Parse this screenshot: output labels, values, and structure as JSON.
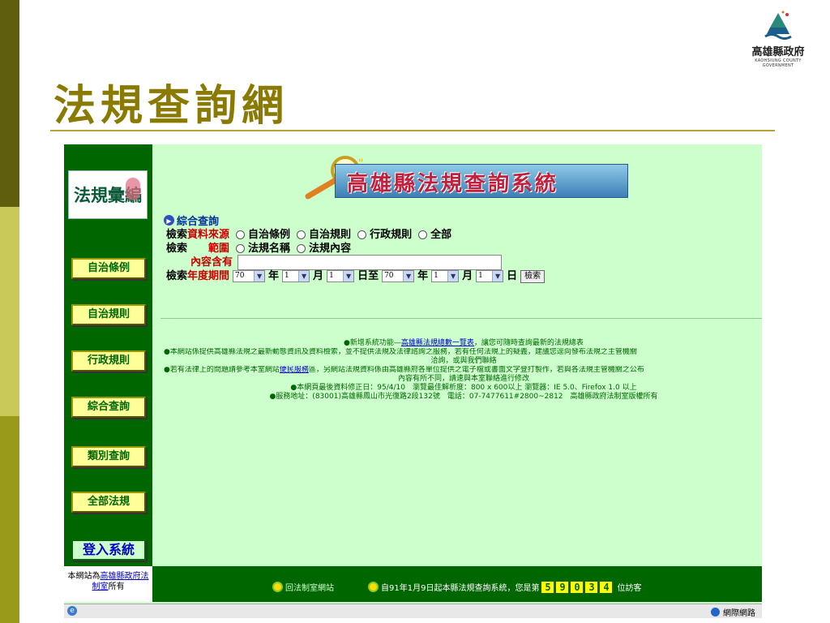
{
  "slide": {
    "title": "法規查詢網",
    "logo_name": "高雄縣政府",
    "logo_sub": "KAOHSIUNG COUNTY GOVERNMENT"
  },
  "sidebar": {
    "logo_label": "法規彙編",
    "items": [
      {
        "label": "自治條例"
      },
      {
        "label": "自治規則"
      },
      {
        "label": "行政規則"
      },
      {
        "label": "綜合查詢"
      },
      {
        "label": "類別查詢"
      },
      {
        "label": "全部法規"
      },
      {
        "label": "登入系統"
      }
    ],
    "footer_prefix": "本網站為",
    "footer_link": "高雄縣政府法制室",
    "footer_suffix": "所有"
  },
  "banner": {
    "title": "高雄縣法規查詢系統"
  },
  "search": {
    "heading": "綜合查詢",
    "source_prefix": "檢索",
    "source_label": "資料來源",
    "source_options": [
      "自治條例",
      "自治規則",
      "行政規則",
      "全部"
    ],
    "scope_prefix": "檢索",
    "scope_label": "範圍",
    "scope_options": [
      "法規名稱",
      "法規內容"
    ],
    "content_label": "內容含有",
    "content_value": "",
    "period_prefix": "檢索",
    "period_label": "年度期間",
    "year_from": "70",
    "month_from": "1",
    "day_from": "1",
    "year_to": "70",
    "month_to": "1",
    "day_to": "1",
    "unit_year": "年",
    "unit_month": "月",
    "unit_day_to": "日至",
    "unit_day": "日",
    "button": "檢索"
  },
  "notice": {
    "line1_prefix": "●新增系統功能—",
    "line1_link": "高雄縣法規總數一覽表",
    "line1_suffix": "，讓您可隨時查詢最新的法規總表",
    "line2": "●本網站係提供高雄縣法規之最新動態資訊及資料檢索，並不提供法規及法律諮詢之服務，若有任何法規上的疑義，建議您逕向發布法規之主管機關",
    "line3": "洽詢，或與我們聯絡",
    "line4_prefix": "●若有法律上的問題請參考本室網站",
    "line4_link": "便民服務",
    "line4_suffix": "區，另網站法規資料係由高雄縣府各單位提供之電子檔或書面文字登打製作，若與各法規主管機關之公布",
    "line5": "內容有所不同，請速與本室聯絡進行修改",
    "line6": "●本網頁最後資料修正日：95/4/10　瀏覽最佳解析度：800 x 600以上 瀏覽器：IE 5.0、Firefox 1.0 以上",
    "line7": "●服務地址：(83001)高雄縣鳳山市光復路2段132號　電話：07-7477611#2800~2812　高雄縣政府法制室版權所有"
  },
  "footer": {
    "home_link": "回法制室網站",
    "visitor_prefix": "自91年1月9日起本縣法規查詢系統，您是第",
    "visitor_digits": [
      "5",
      "9",
      "0",
      "3",
      "4"
    ],
    "visitor_suffix": "位訪客"
  },
  "statusbar": {
    "zone": "網際網路"
  }
}
